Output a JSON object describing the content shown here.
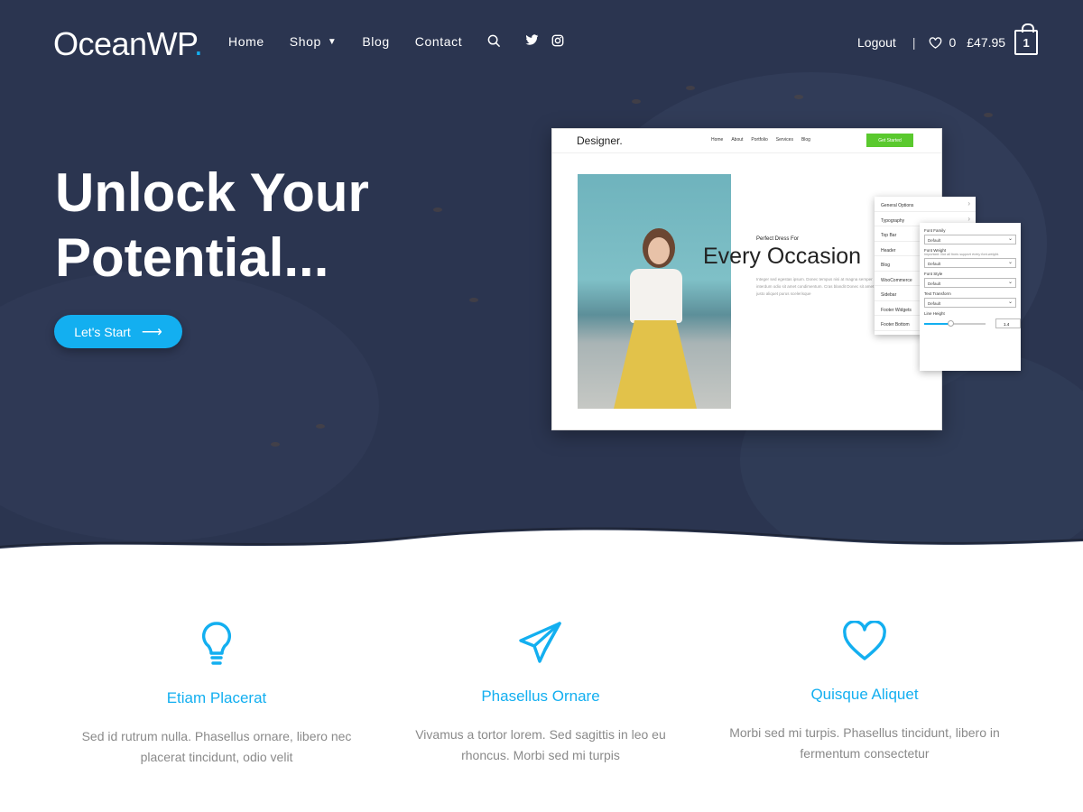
{
  "header": {
    "logo_text": "OceanWP",
    "logo_dot": ".",
    "nav": [
      {
        "label": "Home"
      },
      {
        "label": "Shop",
        "has_dropdown": true
      },
      {
        "label": "Blog"
      },
      {
        "label": "Contact"
      }
    ],
    "icons": [
      "search-icon",
      "twitter-icon",
      "instagram-icon"
    ],
    "logout_label": "Logout",
    "separator": "|",
    "wishlist_count": "0",
    "cart_total": "£47.95",
    "cart_count": "1"
  },
  "hero": {
    "title_line1": "Unlock Your",
    "title_line2": "Potential...",
    "cta_label": "Let's Start",
    "cta_icon": "arrow-right-icon"
  },
  "mockup": {
    "logo": "Designer.",
    "nav": [
      "Home",
      "About",
      "Portfolio",
      "Services",
      "Blog"
    ],
    "cta": "Get Started",
    "subtitle": "Perfect Dress For",
    "title": "Every Occasion",
    "text": "Integer sed egestas ipsum. Donec tempus nisi at magna semper interdum odio sit amet condimentum. Cras blandit Donec sit amet justo aliquet purus scelerisque",
    "panel_menu": [
      "General Options",
      "Typography",
      "Top Bar",
      "Header",
      "Blog",
      "WooCommerce",
      "Sidebar",
      "Footer Widgets",
      "Footer Bottom"
    ],
    "panel_fields": {
      "font_family_label": "Font Family",
      "font_family_value": "Default",
      "font_weight_label": "Font Weight",
      "font_weight_note": "Important: Not all fonts support every font-weight.",
      "font_weight_value": "Default",
      "font_style_label": "Font Style",
      "font_style_value": "Default",
      "text_transform_label": "Text Transform",
      "text_transform_value": "Default",
      "line_height_label": "Line Height",
      "line_height_value": "1.4"
    }
  },
  "features": [
    {
      "icon": "lightbulb-icon",
      "title": "Etiam Placerat",
      "line1": "Sed id rutrum nulla. Phasellus ornare, libero nec",
      "line2": "placerat tincidunt, odio velit"
    },
    {
      "icon": "paper-plane-icon",
      "title": "Phasellus Ornare",
      "line1": "Vivamus a tortor lorem. Sed sagittis in leo eu",
      "line2": "rhoncus. Morbi sed mi turpis"
    },
    {
      "icon": "heart-icon",
      "title": "Quisque Aliquet",
      "line1": "Morbi sed mi turpis. Phasellus tincidunt, libero in",
      "line2": "fermentum consectetur"
    }
  ],
  "colors": {
    "accent": "#13aff0",
    "hero_bg": "#2b3550",
    "green": "#5ac92e"
  }
}
